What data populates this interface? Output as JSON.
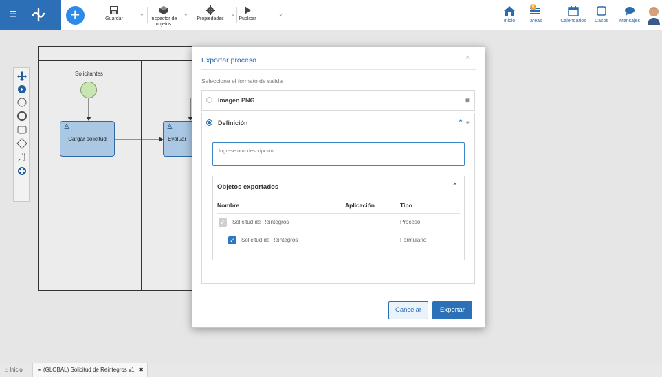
{
  "toolbar": {
    "guardar": "Guardar",
    "inspector": "Inspector de objetos",
    "propiedades": "Propiedades",
    "publicar": "Publicar"
  },
  "nav": {
    "inicio": "Inicio",
    "tareas": "Tareas",
    "tareas_badge": "0",
    "calendarios": "Calendarios",
    "casos": "Casos",
    "mensajes": "Mensajes"
  },
  "diagram": {
    "lane1_title": "Solicitantes",
    "task1": "Cargar solicitud",
    "task2": "Evaluar"
  },
  "modal": {
    "title": "Exportar proceso",
    "subtitle": "Seleccione el formato de salida",
    "option_png": "Imagen PNG",
    "option_def": "Definición",
    "description_placeholder": "Ingrese una descripción...",
    "objects_title": "Objetos exportados",
    "col_nombre": "Nombre",
    "col_aplicacion": "Aplicación",
    "col_tipo": "Tipo",
    "rows": [
      {
        "nombre": "Solicitud de Reintegros",
        "aplicacion": "",
        "tipo": "Proceso"
      },
      {
        "nombre": "Solicitud de Reintegros",
        "aplicacion": "",
        "tipo": "Formulario"
      }
    ],
    "cancel": "Cancelar",
    "export": "Exportar"
  },
  "bottom_tabs": {
    "home": "Inicio",
    "active": "(GLOBAL) Solicitud de Reintegros v1"
  },
  "colors": {
    "brand": "#2c6fb6",
    "accent": "#2c70b8"
  }
}
